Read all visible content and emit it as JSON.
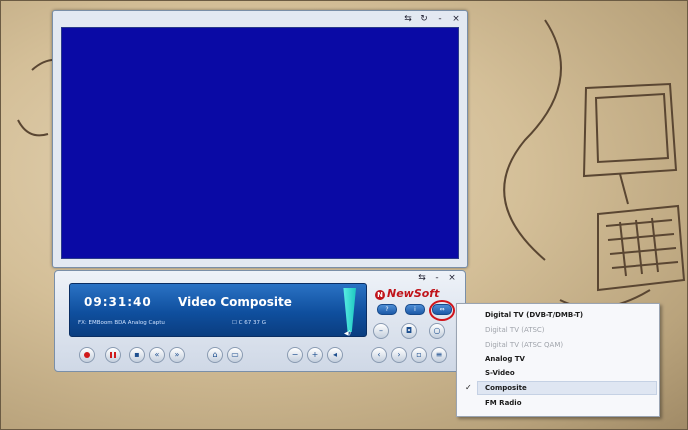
{
  "display": {
    "time": "09:31:40",
    "source": "Video Composite",
    "device_line": "FX: EMBoom BDA Analog Captu",
    "channel_line": "☐ C 67 37 G"
  },
  "brand": {
    "logo_text": "NewSoft"
  },
  "window_controls": {
    "pin": "⇆",
    "restore": "↻",
    "minimize": "-",
    "close": "×"
  },
  "control_controls": {
    "pin": "⇆",
    "minimize": "-",
    "close": "×"
  },
  "menu": {
    "items": [
      {
        "label": "Digital TV (DVB-T/DMB-T)",
        "enabled": true,
        "checked": false
      },
      {
        "label": "Digital TV (ATSC)",
        "enabled": false,
        "checked": false
      },
      {
        "label": "Digital TV (ATSC QAM)",
        "enabled": false,
        "checked": false
      },
      {
        "label": "Analog TV",
        "enabled": true,
        "checked": false
      },
      {
        "label": "S-Video",
        "enabled": true,
        "checked": false
      },
      {
        "label": "Composite",
        "enabled": true,
        "checked": true
      },
      {
        "label": "FM Radio",
        "enabled": true,
        "checked": false
      }
    ],
    "check_mark": "✓"
  },
  "icons": {
    "record": "record-icon",
    "pause": "pause-icon",
    "stop": "stop-icon",
    "rewind": "rewind-icon",
    "forward": "forward-icon",
    "home": "home-icon",
    "folder": "folder-icon",
    "minus": "minus-icon",
    "plus": "plus-icon",
    "speaker": "speaker-icon",
    "source": "source-select-icon"
  },
  "colors": {
    "video_bg": "#0a0aa5",
    "lcd_blue": "#0f4f9e",
    "accent_red": "#c0141b",
    "volume_cyan": "#2ad8d0"
  }
}
